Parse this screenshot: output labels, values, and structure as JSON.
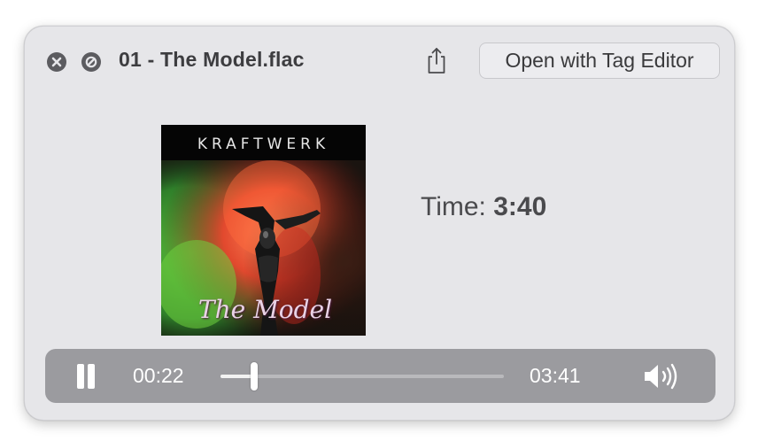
{
  "window": {
    "title": "01 - The Model.flac",
    "open_button_label": "Open with Tag Editor"
  },
  "icons": {
    "close": "close-icon",
    "block": "block-icon",
    "share": "share-icon",
    "pause": "pause-icon",
    "volume": "volume-icon"
  },
  "artwork": {
    "brand_text": "KRAFTWERK",
    "album_text": "The Model"
  },
  "info": {
    "time_label": "Time:",
    "time_value": "3:40"
  },
  "player": {
    "elapsed": "00:22",
    "total": "03:41",
    "progress_fraction": 0.12,
    "state": "playing"
  },
  "colors": {
    "window_bg": "#e6e6e9",
    "player_bg": "#9b9b9f",
    "title_text": "#3d3d40"
  }
}
